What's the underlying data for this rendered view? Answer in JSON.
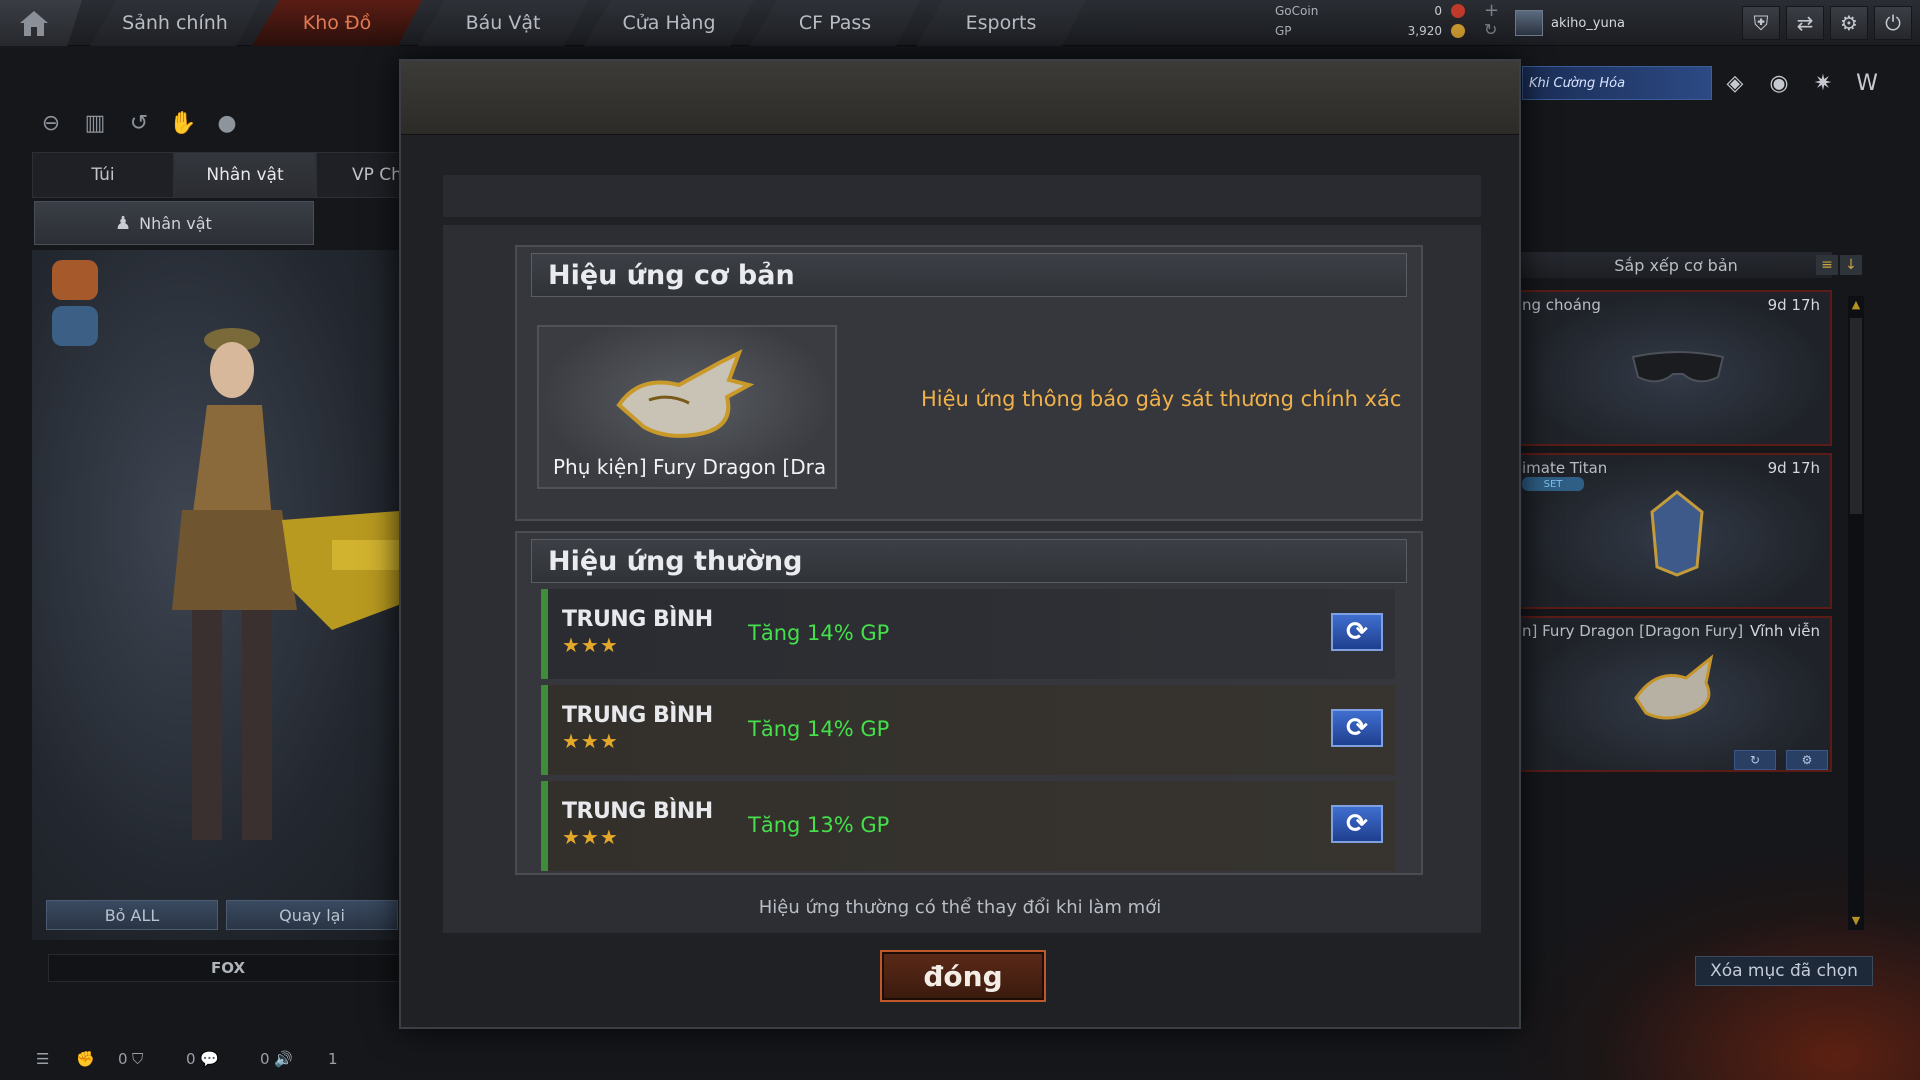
{
  "nav": {
    "tabs": [
      "Sảnh chính",
      "Kho Đồ",
      "Báu Vật",
      "Cửa Hàng",
      "CF Pass",
      "Esports"
    ],
    "active": "Kho Đồ"
  },
  "currency": {
    "gocoin_label": "GoCoin",
    "gp_label": "GP",
    "gocoin_value": "0",
    "gp_value": "3,920"
  },
  "user": {
    "name": "akiho_yuna"
  },
  "left": {
    "tabs": [
      "Túi",
      "Nhân vật",
      "VP Chức"
    ],
    "sub_tab": "Nhân vật",
    "btn_remove_all": "Bỏ ALL",
    "btn_back": "Quay lại",
    "char_name": "FOX"
  },
  "status_bar": {
    "count1": "0",
    "count2": "0",
    "count3": "0",
    "count4": "1"
  },
  "right": {
    "banner": "Khi Cường Hóa",
    "sort_label": "Sắp xếp cơ bản",
    "items": [
      {
        "name": "ng choáng",
        "time": "9d 17h"
      },
      {
        "name": "imate Titan",
        "time": "9d 17h",
        "badge": "SET"
      },
      {
        "name": "n] Fury Dragon [Dragon Fury]",
        "time": "Vĩnh viễn"
      }
    ],
    "clear_btn": "Xóa mục đã chọn"
  },
  "modal": {
    "basic_title": "Hiệu ứng cơ bản",
    "basic_item_label": "Phụ kiện] Fury Dragon [Dragon Fury]",
    "basic_effect": "Hiệu ứng thông báo gây sát thương chính xác",
    "normal_title": "Hiệu ứng thường",
    "effects": [
      {
        "rank": "TRUNG BÌNH",
        "stars": "★★★",
        "text": "Tăng 14% GP"
      },
      {
        "rank": "TRUNG BÌNH",
        "stars": "★★★",
        "text": "Tăng 14% GP"
      },
      {
        "rank": "TRUNG BÌNH",
        "stars": "★★★",
        "text": "Tăng 13% GP"
      }
    ],
    "footnote": "Hiệu ứng thường có thể thay đổi khi làm mới",
    "close_label": "đóng"
  },
  "colors": {
    "accent_orange": "#f0b14a",
    "effect_green": "#44e04c",
    "star_gold": "#e4a92a",
    "refresh_blue": "#2f58b8"
  }
}
